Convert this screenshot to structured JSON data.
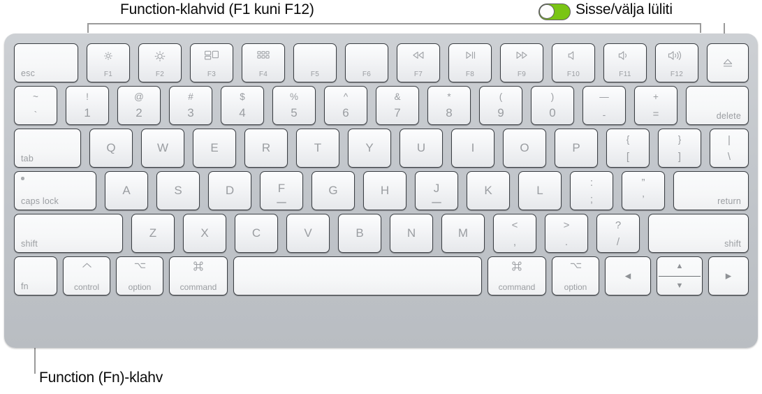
{
  "annotations": {
    "top_left_label": "Function-klahvid (F1 kuni F12)",
    "top_right_label": "Sisse/välja lüliti",
    "bottom_label": "Function (Fn)-klahv",
    "toggle_state": "on",
    "toggle_color": "#7ac514"
  },
  "keyboard": {
    "rows": [
      {
        "name": "function-row",
        "keys": [
          {
            "name": "esc",
            "label": "esc",
            "icon": null,
            "fnum": null
          },
          {
            "name": "f1",
            "label": null,
            "icon": "brightness-down-icon",
            "fnum": "F1"
          },
          {
            "name": "f2",
            "label": null,
            "icon": "brightness-up-icon",
            "fnum": "F2"
          },
          {
            "name": "f3",
            "label": null,
            "icon": "mission-control-icon",
            "fnum": "F3"
          },
          {
            "name": "f4",
            "label": null,
            "icon": "launchpad-icon",
            "fnum": "F4"
          },
          {
            "name": "f5",
            "label": null,
            "icon": null,
            "fnum": "F5"
          },
          {
            "name": "f6",
            "label": null,
            "icon": null,
            "fnum": "F6"
          },
          {
            "name": "f7",
            "label": null,
            "icon": "rewind-icon",
            "fnum": "F7"
          },
          {
            "name": "f8",
            "label": null,
            "icon": "play-pause-icon",
            "fnum": "F8"
          },
          {
            "name": "f9",
            "label": null,
            "icon": "fast-forward-icon",
            "fnum": "F9"
          },
          {
            "name": "f10",
            "label": null,
            "icon": "volume-mute-icon",
            "fnum": "F10"
          },
          {
            "name": "f11",
            "label": null,
            "icon": "volume-down-icon",
            "fnum": "F11"
          },
          {
            "name": "f12",
            "label": null,
            "icon": "volume-up-icon",
            "fnum": "F12"
          },
          {
            "name": "eject",
            "label": null,
            "icon": "eject-icon",
            "fnum": null
          }
        ]
      },
      {
        "name": "number-row",
        "keys": [
          {
            "name": "grave",
            "upper": "~",
            "lower": "`"
          },
          {
            "name": "digit-1",
            "upper": "!",
            "lower": "1"
          },
          {
            "name": "digit-2",
            "upper": "@",
            "lower": "2"
          },
          {
            "name": "digit-3",
            "upper": "#",
            "lower": "3"
          },
          {
            "name": "digit-4",
            "upper": "$",
            "lower": "4"
          },
          {
            "name": "digit-5",
            "upper": "%",
            "lower": "5"
          },
          {
            "name": "digit-6",
            "upper": "^",
            "lower": "6"
          },
          {
            "name": "digit-7",
            "upper": "&",
            "lower": "7"
          },
          {
            "name": "digit-8",
            "upper": "*",
            "lower": "8"
          },
          {
            "name": "digit-9",
            "upper": "(",
            "lower": "9"
          },
          {
            "name": "digit-0",
            "upper": ")",
            "lower": "0"
          },
          {
            "name": "minus",
            "upper": "—",
            "lower": "-"
          },
          {
            "name": "equal",
            "upper": "+",
            "lower": "="
          },
          {
            "name": "delete",
            "label": "delete"
          }
        ]
      },
      {
        "name": "qwerty-row",
        "keys": [
          {
            "name": "tab",
            "label": "tab"
          },
          {
            "name": "key-q",
            "center": "Q"
          },
          {
            "name": "key-w",
            "center": "W"
          },
          {
            "name": "key-e",
            "center": "E"
          },
          {
            "name": "key-r",
            "center": "R"
          },
          {
            "name": "key-t",
            "center": "T"
          },
          {
            "name": "key-y",
            "center": "Y"
          },
          {
            "name": "key-u",
            "center": "U"
          },
          {
            "name": "key-i",
            "center": "I"
          },
          {
            "name": "key-o",
            "center": "O"
          },
          {
            "name": "key-p",
            "center": "P"
          },
          {
            "name": "bracket-left",
            "upper": "{",
            "lower": "["
          },
          {
            "name": "bracket-right",
            "upper": "}",
            "lower": "]"
          },
          {
            "name": "backslash",
            "upper": "|",
            "lower": "\\"
          }
        ]
      },
      {
        "name": "home-row",
        "keys": [
          {
            "name": "caps-lock",
            "label": "caps lock"
          },
          {
            "name": "key-a",
            "center": "A"
          },
          {
            "name": "key-s",
            "center": "S"
          },
          {
            "name": "key-d",
            "center": "D"
          },
          {
            "name": "key-f",
            "center": "F"
          },
          {
            "name": "key-g",
            "center": "G"
          },
          {
            "name": "key-h",
            "center": "H"
          },
          {
            "name": "key-j",
            "center": "J"
          },
          {
            "name": "key-k",
            "center": "K"
          },
          {
            "name": "key-l",
            "center": "L"
          },
          {
            "name": "semicolon",
            "upper": ":",
            "lower": ";"
          },
          {
            "name": "quote",
            "upper": "”",
            "lower": "’"
          },
          {
            "name": "return",
            "label": "return"
          }
        ]
      },
      {
        "name": "shift-row",
        "keys": [
          {
            "name": "shift-left",
            "label": "shift"
          },
          {
            "name": "key-z",
            "center": "Z"
          },
          {
            "name": "key-x",
            "center": "X"
          },
          {
            "name": "key-c",
            "center": "C"
          },
          {
            "name": "key-v",
            "center": "V"
          },
          {
            "name": "key-b",
            "center": "B"
          },
          {
            "name": "key-n",
            "center": "N"
          },
          {
            "name": "key-m",
            "center": "M"
          },
          {
            "name": "comma",
            "upper": "<",
            "lower": ","
          },
          {
            "name": "period",
            "upper": ">",
            "lower": "."
          },
          {
            "name": "slash",
            "upper": "?",
            "lower": "/"
          },
          {
            "name": "shift-right",
            "label": "shift"
          }
        ]
      },
      {
        "name": "bottom-row",
        "keys": [
          {
            "name": "fn",
            "label": "fn",
            "icon": null
          },
          {
            "name": "control-left",
            "label": "control",
            "icon": "control-caret-icon"
          },
          {
            "name": "option-left",
            "label": "option",
            "icon": "option-icon"
          },
          {
            "name": "command-left",
            "label": "command",
            "icon": "command-icon"
          },
          {
            "name": "space",
            "label": null,
            "icon": null
          },
          {
            "name": "command-right",
            "label": "command",
            "icon": "command-icon"
          },
          {
            "name": "option-right",
            "label": "option",
            "icon": "option-icon"
          },
          {
            "name": "arrow-left",
            "label": null,
            "icon": "arrow-left-icon"
          },
          {
            "name": "arrow-up-down",
            "label": null,
            "icon": "arrow-up-down-icon"
          },
          {
            "name": "arrow-right",
            "label": null,
            "icon": "arrow-right-icon"
          }
        ]
      }
    ]
  }
}
